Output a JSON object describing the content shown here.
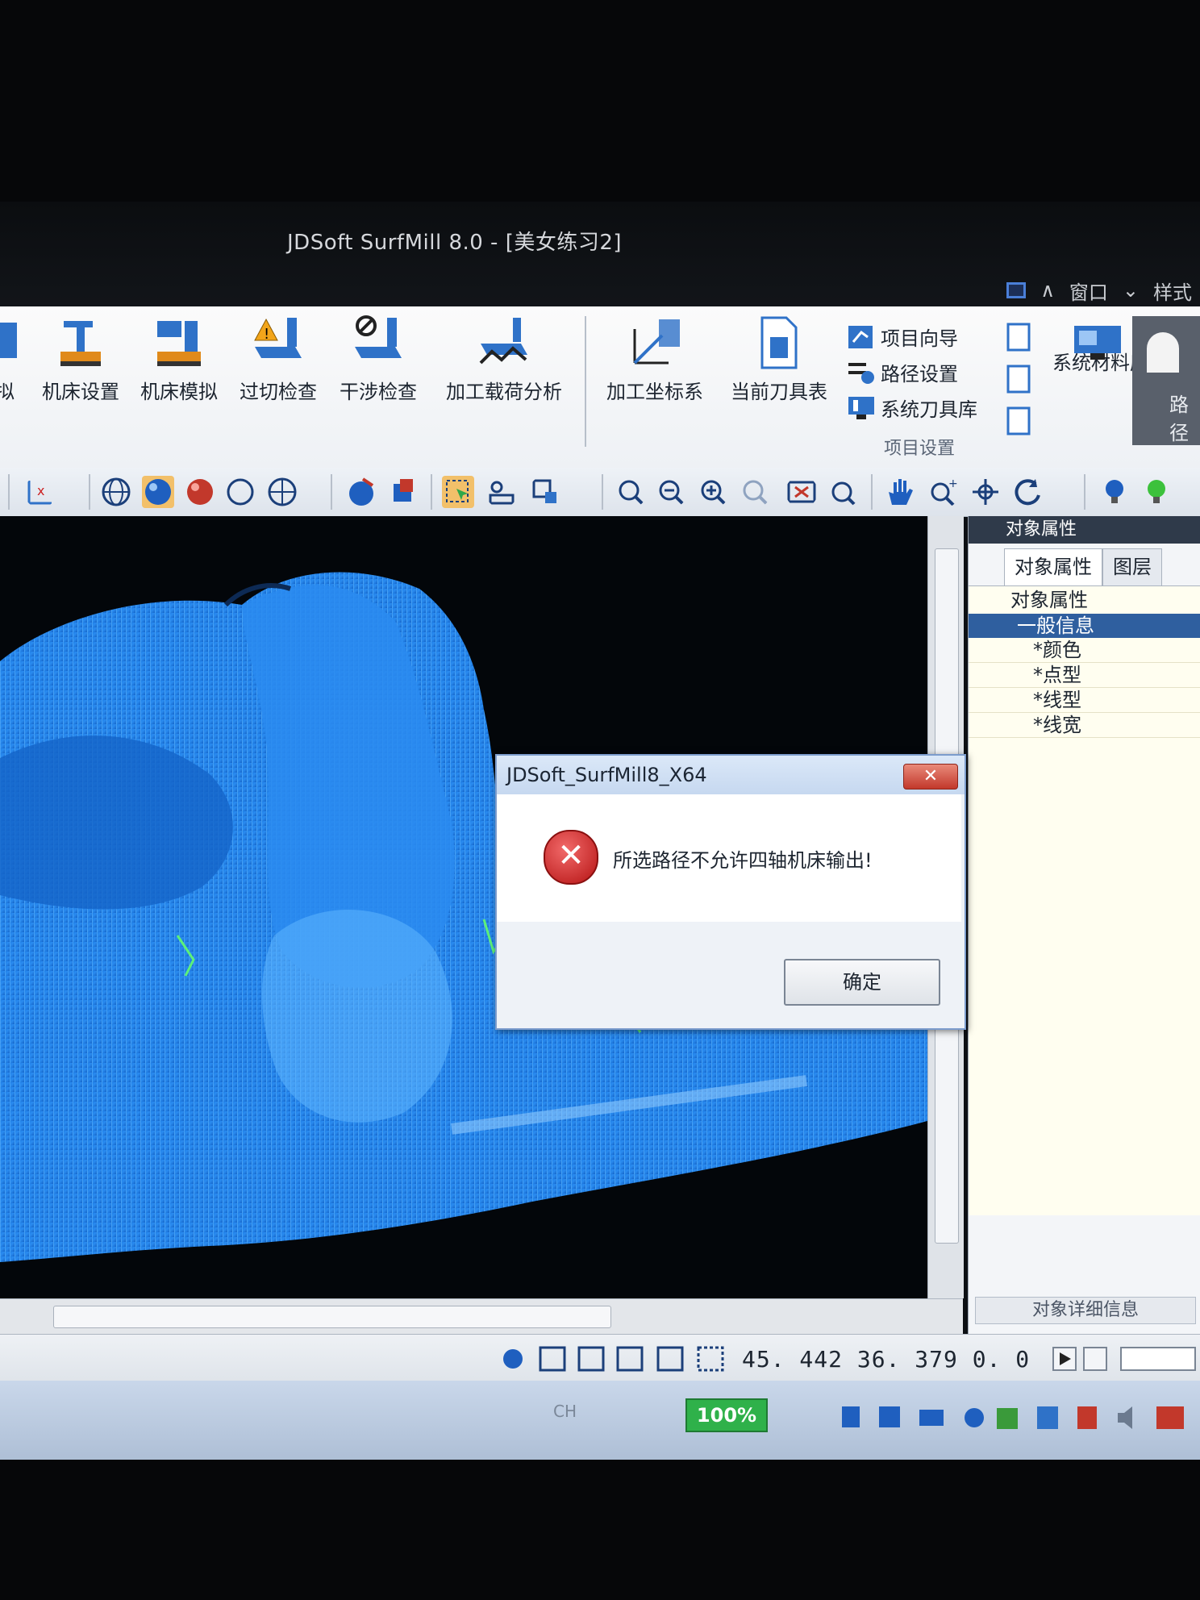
{
  "window": {
    "title": "JDSoft SurfMill 8.0 - [美女练习2]",
    "menu_window": "窗口",
    "menu_style": "样式"
  },
  "ribbon": {
    "large_buttons": [
      {
        "label": "拟",
        "icon": "simulate-icon"
      },
      {
        "label": "机床设置",
        "icon": "machine-setup-icon"
      },
      {
        "label": "机床模拟",
        "icon": "machine-simulate-icon"
      },
      {
        "label": "过切检查",
        "icon": "overcut-check-icon"
      },
      {
        "label": "干涉检查",
        "icon": "interference-check-icon"
      },
      {
        "label": "加工载荷分析",
        "icon": "load-analysis-icon"
      },
      {
        "label": "加工坐标系",
        "icon": "coordinate-system-icon"
      },
      {
        "label": "当前刀具表",
        "icon": "tool-table-icon"
      }
    ],
    "small_commands": [
      {
        "label": "项目向导",
        "icon": "project-wizard-icon"
      },
      {
        "label": "路径设置",
        "icon": "path-settings-icon"
      },
      {
        "label": "系统刀具库",
        "icon": "system-tool-library-icon"
      }
    ],
    "group_label": "项目设置",
    "material_library": "系统材料库",
    "path_partial": "路径"
  },
  "panel": {
    "title": "对象属性",
    "tabs": [
      "对象属性",
      "图层"
    ],
    "tree_header": "对象属性",
    "group": "一般信息",
    "items": [
      "*颜色",
      "*点型",
      "*线型",
      "*线宽"
    ],
    "footer": "对象详细信息"
  },
  "dialog": {
    "title": "JDSoft_SurfMill8_X64",
    "close_label": "✕",
    "message": "所选路径不允许四轴机床输出!",
    "ok_label": "确定"
  },
  "status": {
    "coords": "45. 442  36. 379  0. 0",
    "battery": "100%",
    "lang": "CH"
  },
  "colors": {
    "model_blue": "#1f7fe6",
    "model_light": "#5fb7ff",
    "dialog_border": "#7c9ccc",
    "error_red": "#c2382b",
    "battery_green": "#2fb14a"
  }
}
